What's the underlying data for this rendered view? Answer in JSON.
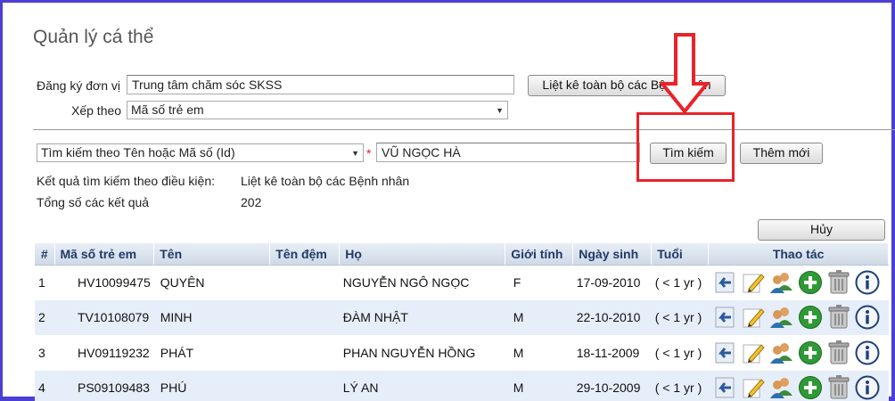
{
  "page": {
    "title": "Quản lý cá thể"
  },
  "form": {
    "unit_label": "Đăng ký đơn vị",
    "unit_value": "Trung tâm chăm sóc SKSS",
    "list_all_button": "Liệt kê toàn bộ các Bệnh nhân",
    "sort_label": "Xếp theo",
    "sort_value": "Mã số trẻ em"
  },
  "search": {
    "mode_value": "Tìm kiếm theo Tên hoặc Mã số (Id)",
    "required_mark": "*",
    "query_value": "VŨ NGỌC HÀ",
    "search_button": "Tìm kiếm",
    "add_button": "Thêm mới"
  },
  "results": {
    "condition_label": "Kết quả tìm kiếm theo điều kiện:",
    "condition_value": "Liệt kê toàn bộ các Bệnh nhân",
    "total_label": "Tổng số các kết quả",
    "total_value": "202",
    "cancel_button": "Hủy"
  },
  "table": {
    "headers": {
      "num": "#",
      "code": "Mã số trẻ em",
      "first": "Tên",
      "middle": "Tên đệm",
      "last": "Họ",
      "sex": "Giới tính",
      "dob": "Ngày sinh",
      "age": "Tuổi",
      "actions": "Thao tác"
    },
    "rows": [
      {
        "num": "1",
        "code": "HV10099475",
        "first": "QUYÊN",
        "middle": "",
        "last": "NGUYỄN NGÔ NGỌC",
        "sex": "F",
        "dob": "17-09-2010",
        "age": "( < 1 yr )"
      },
      {
        "num": "2",
        "code": "TV10108079",
        "first": "MINH",
        "middle": "",
        "last": "ĐÀM NHẬT",
        "sex": "M",
        "dob": "22-10-2010",
        "age": "( < 1 yr )"
      },
      {
        "num": "3",
        "code": "HV09119232",
        "first": "PHÁT",
        "middle": "",
        "last": "PHAN NGUYỄN HỒNG",
        "sex": "M",
        "dob": "18-11-2009",
        "age": "( < 1 yr )"
      },
      {
        "num": "4",
        "code": "PS09109483",
        "first": "PHÚ",
        "middle": "",
        "last": "LÝ AN",
        "sex": "M",
        "dob": "29-10-2009",
        "age": "( < 1 yr )"
      }
    ],
    "action_icons": [
      "back-arrow-icon",
      "edit-pencil-icon",
      "users-icon",
      "add-plus-icon",
      "trash-icon",
      "info-icon"
    ]
  },
  "annotation": {
    "arrow_color": "#e8232a",
    "border_color": "#4b3fd6"
  }
}
